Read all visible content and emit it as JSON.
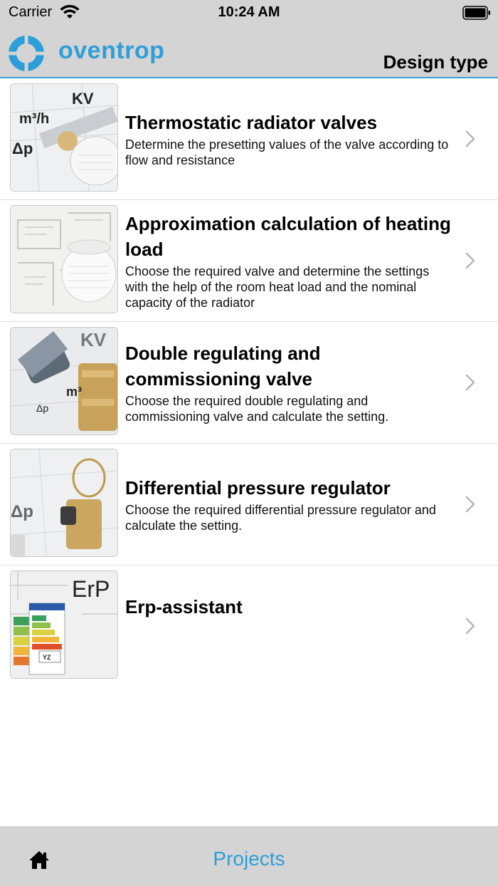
{
  "status": {
    "carrier": "Carrier",
    "time": "10:24 AM"
  },
  "header": {
    "brand": "oventrop",
    "title": "Design type"
  },
  "items": [
    {
      "title": "Thermostatic radiator valves",
      "description": "Determine the presetting values of the valve according to flow and resistance",
      "thumb_labels": [
        "KV",
        "m³/h",
        "Δp"
      ]
    },
    {
      "title": "Approximation calculation of heating load",
      "description": "Choose the required valve and determine the settings with the help of the room heat load and the nominal capacity of the radiator",
      "thumb_labels": []
    },
    {
      "title": "Double regulating and commissioning valve",
      "description": "Choose the required double regulating and commissioning valve and calculate the setting.",
      "thumb_labels": [
        "KV",
        "m³",
        "Δp"
      ]
    },
    {
      "title": "Differential pressure regulator",
      "description": "Choose the required differential pressure regulator and calculate the setting.",
      "thumb_labels": [
        "Δp"
      ]
    },
    {
      "title": "Erp-assistant",
      "description": "",
      "thumb_labels": [
        "ErP",
        "YZ"
      ]
    }
  ],
  "tabbar": {
    "home_icon": "home-icon",
    "projects_label": "Projects"
  },
  "colors": {
    "accent": "#2d9fd8",
    "bar_bg": "#d4d4d4"
  }
}
